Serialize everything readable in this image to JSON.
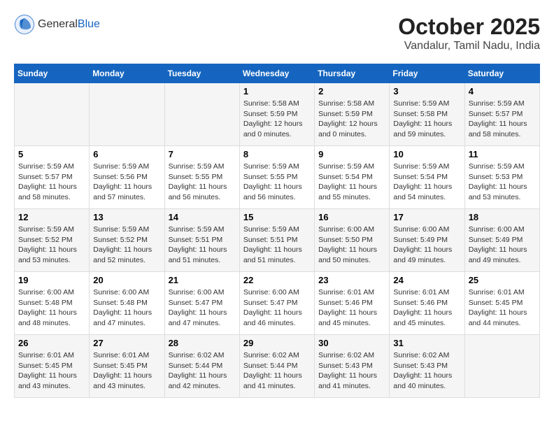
{
  "header": {
    "logo_general": "General",
    "logo_blue": "Blue",
    "month_title": "October 2025",
    "location": "Vandalur, Tamil Nadu, India"
  },
  "weekdays": [
    "Sunday",
    "Monday",
    "Tuesday",
    "Wednesday",
    "Thursday",
    "Friday",
    "Saturday"
  ],
  "weeks": [
    [
      {
        "day": "",
        "sunrise": "",
        "sunset": "",
        "daylight": ""
      },
      {
        "day": "",
        "sunrise": "",
        "sunset": "",
        "daylight": ""
      },
      {
        "day": "",
        "sunrise": "",
        "sunset": "",
        "daylight": ""
      },
      {
        "day": "1",
        "sunrise": "Sunrise: 5:58 AM",
        "sunset": "Sunset: 5:59 PM",
        "daylight": "Daylight: 12 hours and 0 minutes."
      },
      {
        "day": "2",
        "sunrise": "Sunrise: 5:58 AM",
        "sunset": "Sunset: 5:59 PM",
        "daylight": "Daylight: 12 hours and 0 minutes."
      },
      {
        "day": "3",
        "sunrise": "Sunrise: 5:59 AM",
        "sunset": "Sunset: 5:58 PM",
        "daylight": "Daylight: 11 hours and 59 minutes."
      },
      {
        "day": "4",
        "sunrise": "Sunrise: 5:59 AM",
        "sunset": "Sunset: 5:57 PM",
        "daylight": "Daylight: 11 hours and 58 minutes."
      }
    ],
    [
      {
        "day": "5",
        "sunrise": "Sunrise: 5:59 AM",
        "sunset": "Sunset: 5:57 PM",
        "daylight": "Daylight: 11 hours and 58 minutes."
      },
      {
        "day": "6",
        "sunrise": "Sunrise: 5:59 AM",
        "sunset": "Sunset: 5:56 PM",
        "daylight": "Daylight: 11 hours and 57 minutes."
      },
      {
        "day": "7",
        "sunrise": "Sunrise: 5:59 AM",
        "sunset": "Sunset: 5:55 PM",
        "daylight": "Daylight: 11 hours and 56 minutes."
      },
      {
        "day": "8",
        "sunrise": "Sunrise: 5:59 AM",
        "sunset": "Sunset: 5:55 PM",
        "daylight": "Daylight: 11 hours and 56 minutes."
      },
      {
        "day": "9",
        "sunrise": "Sunrise: 5:59 AM",
        "sunset": "Sunset: 5:54 PM",
        "daylight": "Daylight: 11 hours and 55 minutes."
      },
      {
        "day": "10",
        "sunrise": "Sunrise: 5:59 AM",
        "sunset": "Sunset: 5:54 PM",
        "daylight": "Daylight: 11 hours and 54 minutes."
      },
      {
        "day": "11",
        "sunrise": "Sunrise: 5:59 AM",
        "sunset": "Sunset: 5:53 PM",
        "daylight": "Daylight: 11 hours and 53 minutes."
      }
    ],
    [
      {
        "day": "12",
        "sunrise": "Sunrise: 5:59 AM",
        "sunset": "Sunset: 5:52 PM",
        "daylight": "Daylight: 11 hours and 53 minutes."
      },
      {
        "day": "13",
        "sunrise": "Sunrise: 5:59 AM",
        "sunset": "Sunset: 5:52 PM",
        "daylight": "Daylight: 11 hours and 52 minutes."
      },
      {
        "day": "14",
        "sunrise": "Sunrise: 5:59 AM",
        "sunset": "Sunset: 5:51 PM",
        "daylight": "Daylight: 11 hours and 51 minutes."
      },
      {
        "day": "15",
        "sunrise": "Sunrise: 5:59 AM",
        "sunset": "Sunset: 5:51 PM",
        "daylight": "Daylight: 11 hours and 51 minutes."
      },
      {
        "day": "16",
        "sunrise": "Sunrise: 6:00 AM",
        "sunset": "Sunset: 5:50 PM",
        "daylight": "Daylight: 11 hours and 50 minutes."
      },
      {
        "day": "17",
        "sunrise": "Sunrise: 6:00 AM",
        "sunset": "Sunset: 5:49 PM",
        "daylight": "Daylight: 11 hours and 49 minutes."
      },
      {
        "day": "18",
        "sunrise": "Sunrise: 6:00 AM",
        "sunset": "Sunset: 5:49 PM",
        "daylight": "Daylight: 11 hours and 49 minutes."
      }
    ],
    [
      {
        "day": "19",
        "sunrise": "Sunrise: 6:00 AM",
        "sunset": "Sunset: 5:48 PM",
        "daylight": "Daylight: 11 hours and 48 minutes."
      },
      {
        "day": "20",
        "sunrise": "Sunrise: 6:00 AM",
        "sunset": "Sunset: 5:48 PM",
        "daylight": "Daylight: 11 hours and 47 minutes."
      },
      {
        "day": "21",
        "sunrise": "Sunrise: 6:00 AM",
        "sunset": "Sunset: 5:47 PM",
        "daylight": "Daylight: 11 hours and 47 minutes."
      },
      {
        "day": "22",
        "sunrise": "Sunrise: 6:00 AM",
        "sunset": "Sunset: 5:47 PM",
        "daylight": "Daylight: 11 hours and 46 minutes."
      },
      {
        "day": "23",
        "sunrise": "Sunrise: 6:01 AM",
        "sunset": "Sunset: 5:46 PM",
        "daylight": "Daylight: 11 hours and 45 minutes."
      },
      {
        "day": "24",
        "sunrise": "Sunrise: 6:01 AM",
        "sunset": "Sunset: 5:46 PM",
        "daylight": "Daylight: 11 hours and 45 minutes."
      },
      {
        "day": "25",
        "sunrise": "Sunrise: 6:01 AM",
        "sunset": "Sunset: 5:45 PM",
        "daylight": "Daylight: 11 hours and 44 minutes."
      }
    ],
    [
      {
        "day": "26",
        "sunrise": "Sunrise: 6:01 AM",
        "sunset": "Sunset: 5:45 PM",
        "daylight": "Daylight: 11 hours and 43 minutes."
      },
      {
        "day": "27",
        "sunrise": "Sunrise: 6:01 AM",
        "sunset": "Sunset: 5:45 PM",
        "daylight": "Daylight: 11 hours and 43 minutes."
      },
      {
        "day": "28",
        "sunrise": "Sunrise: 6:02 AM",
        "sunset": "Sunset: 5:44 PM",
        "daylight": "Daylight: 11 hours and 42 minutes."
      },
      {
        "day": "29",
        "sunrise": "Sunrise: 6:02 AM",
        "sunset": "Sunset: 5:44 PM",
        "daylight": "Daylight: 11 hours and 41 minutes."
      },
      {
        "day": "30",
        "sunrise": "Sunrise: 6:02 AM",
        "sunset": "Sunset: 5:43 PM",
        "daylight": "Daylight: 11 hours and 41 minutes."
      },
      {
        "day": "31",
        "sunrise": "Sunrise: 6:02 AM",
        "sunset": "Sunset: 5:43 PM",
        "daylight": "Daylight: 11 hours and 40 minutes."
      },
      {
        "day": "",
        "sunrise": "",
        "sunset": "",
        "daylight": ""
      }
    ]
  ]
}
